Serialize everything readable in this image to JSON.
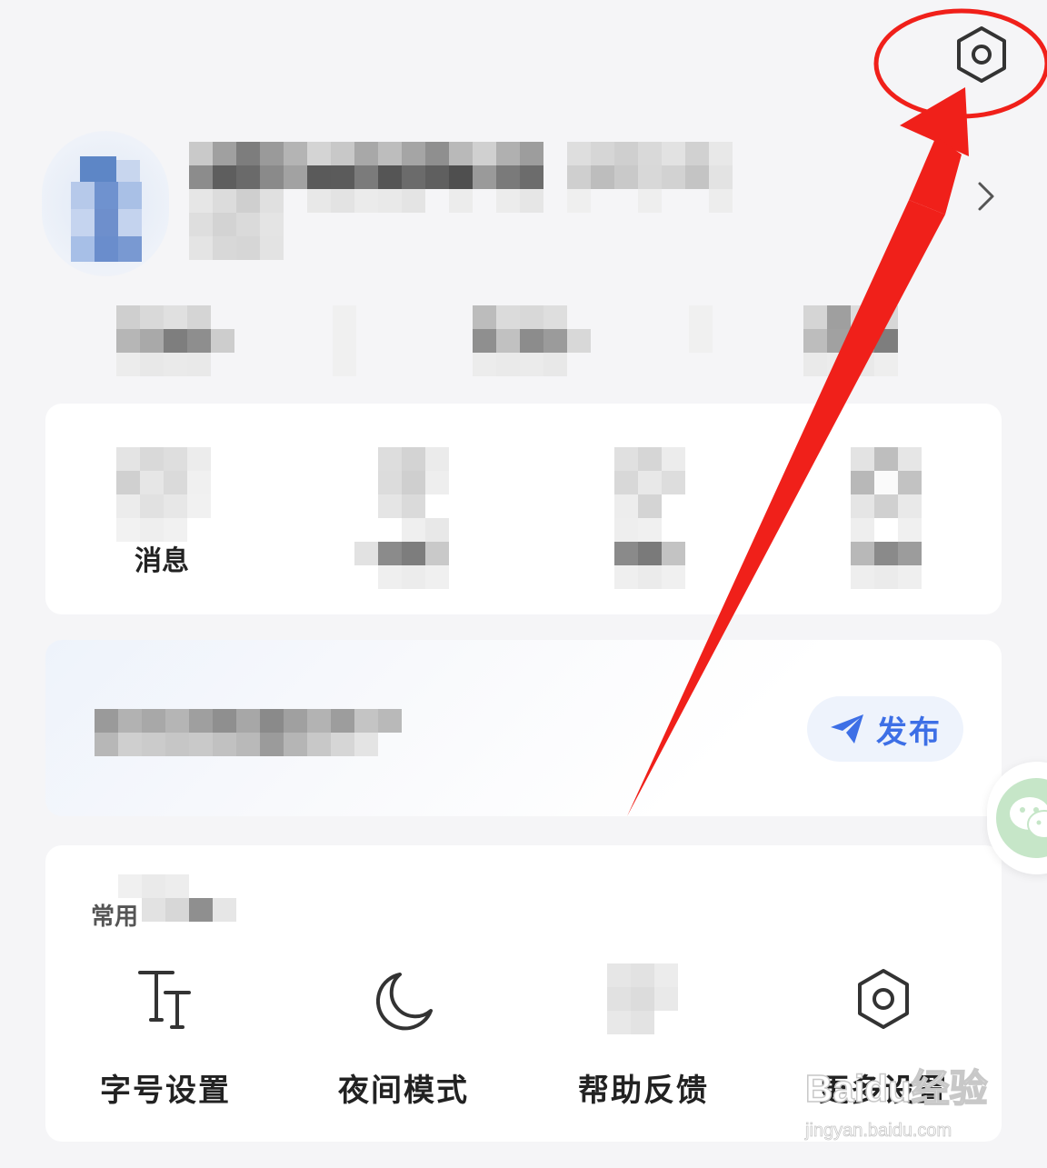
{
  "header": {
    "settings_icon": "hexagon-settings-icon"
  },
  "profile": {
    "chevron_icon": "chevron-right-icon"
  },
  "shortcuts": {
    "first_label": "消息"
  },
  "publish": {
    "label": "发布",
    "icon": "paper-plane-icon"
  },
  "common": {
    "title": "常用",
    "tools": [
      {
        "label": "字号设置",
        "icon": "font-size-icon"
      },
      {
        "label": "夜间模式",
        "icon": "moon-icon"
      },
      {
        "label": "帮助反馈",
        "icon": "help-feedback-icon"
      },
      {
        "label": "更多设置",
        "icon": "hexagon-settings-icon"
      }
    ]
  },
  "floating": {
    "icon": "wechat-icon"
  },
  "watermark": {
    "text": "Baidu经验",
    "url_text": "jingyan.baidu.com"
  },
  "colors": {
    "accent": "#3d6fe6",
    "annotation": "#f0201a",
    "background": "#f5f5f7"
  }
}
